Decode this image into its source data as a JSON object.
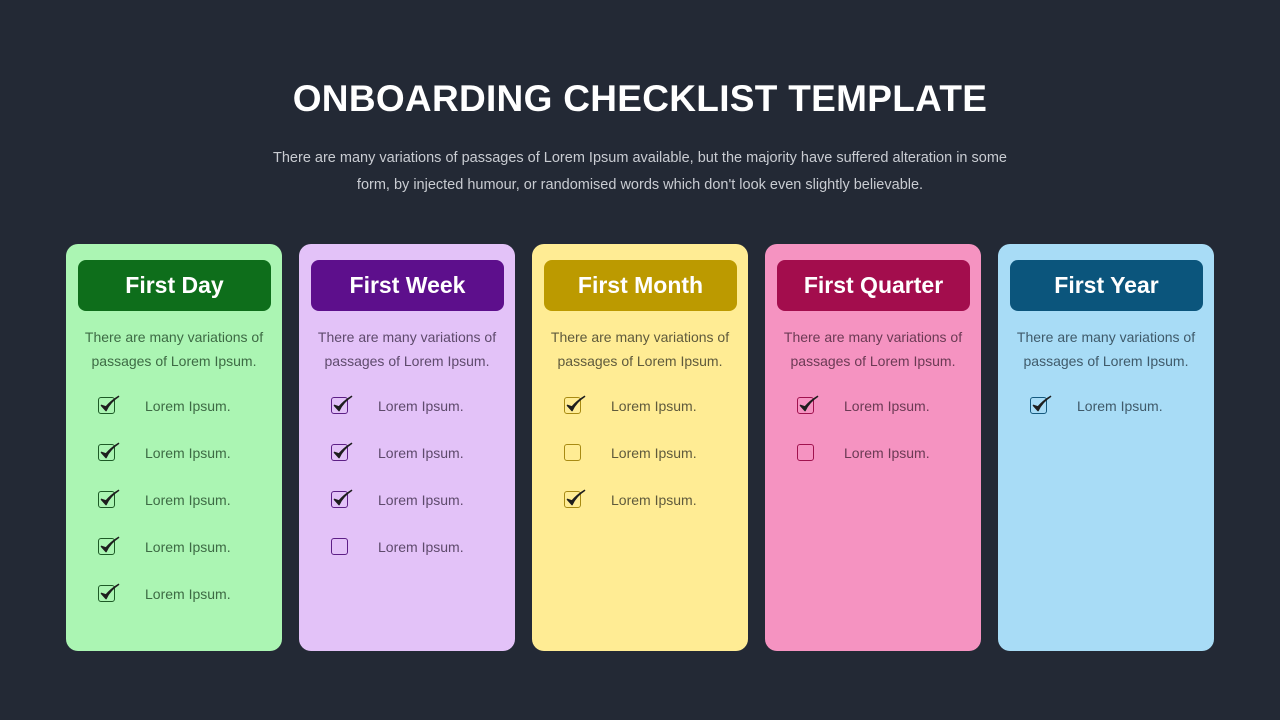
{
  "header": {
    "title": "ONBOARDING CHECKLIST TEMPLATE",
    "subtitle_line1": "There are many variations of passages of Lorem Ipsum available, but the majority have suffered alteration in some",
    "subtitle_line2": "form, by injected humour, or randomised words which don't look even slightly believable."
  },
  "cards": [
    {
      "title": "First Day",
      "desc_line1": "There are many variations of",
      "desc_line2": "passages of Lorem Ipsum.",
      "colors": {
        "bg": "#abf5b3",
        "pill": "#0e6e1b",
        "text": "#3d6a44",
        "box": "#1d5a26"
      },
      "items": [
        {
          "label": "Lorem Ipsum.",
          "checked": true
        },
        {
          "label": "Lorem Ipsum.",
          "checked": true
        },
        {
          "label": "Lorem Ipsum.",
          "checked": true
        },
        {
          "label": "Lorem Ipsum.",
          "checked": true
        },
        {
          "label": "Lorem Ipsum.",
          "checked": true
        }
      ]
    },
    {
      "title": "First Week",
      "desc_line1": "There are many variations of",
      "desc_line2": "passages of Lorem Ipsum.",
      "colors": {
        "bg": "#e3c2f8",
        "pill": "#5d0f8c",
        "text": "#5e4a6c",
        "box": "#5d1f86"
      },
      "items": [
        {
          "label": "Lorem Ipsum.",
          "checked": true
        },
        {
          "label": "Lorem Ipsum.",
          "checked": true
        },
        {
          "label": "Lorem Ipsum.",
          "checked": true
        },
        {
          "label": "Lorem Ipsum.",
          "checked": false
        }
      ]
    },
    {
      "title": "First Month",
      "desc_line1": "There are many variations of",
      "desc_line2": "passages of Lorem Ipsum.",
      "colors": {
        "bg": "#ffec94",
        "pill": "#bc9a00",
        "text": "#5f5a3c",
        "box": "#a88a12"
      },
      "items": [
        {
          "label": "Lorem Ipsum.",
          "checked": true
        },
        {
          "label": "Lorem Ipsum.",
          "checked": false
        },
        {
          "label": "Lorem Ipsum.",
          "checked": true
        }
      ]
    },
    {
      "title": "First Quarter",
      "desc_line1": "There are many variations of",
      "desc_line2": "passages of Lorem Ipsum.",
      "colors": {
        "bg": "#f593c1",
        "pill": "#a30d4d",
        "text": "#6b3a54",
        "box": "#a0124e"
      },
      "items": [
        {
          "label": "Lorem Ipsum.",
          "checked": true
        },
        {
          "label": "Lorem Ipsum.",
          "checked": false
        }
      ]
    },
    {
      "title": "First Year",
      "desc_line1": "There are many variations of",
      "desc_line2": "passages of Lorem Ipsum.",
      "colors": {
        "bg": "#a8dcf6",
        "pill": "#0b557c",
        "text": "#3f5a6a",
        "box": "#15597e"
      },
      "items": [
        {
          "label": "Lorem Ipsum.",
          "checked": true
        }
      ]
    }
  ]
}
